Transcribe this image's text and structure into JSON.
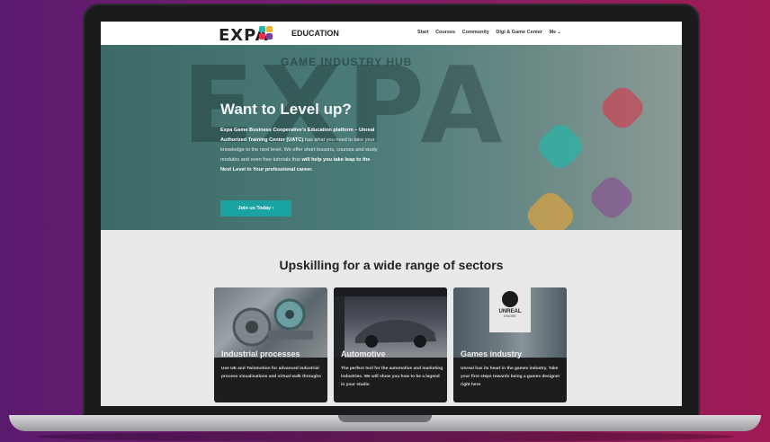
{
  "nav": {
    "logo_text": "EXPA",
    "section": "EDUCATION",
    "items": [
      "Start",
      "Courses",
      "Community",
      "Digi & Game Center",
      "Me"
    ],
    "menu_caret": "⌄"
  },
  "hero": {
    "background_text": "EXPA",
    "background_subtext": "GAME INDUSTRY HUB",
    "title": "Want to Level up?",
    "text_1": "Expa Game Business Cooperative's Education platform – Unreal Authorized Training Center (UATC)",
    "text_2": " has what you need to take your knowledge to the next level. We offer short lessons, courses and study modules and even free tutorials that ",
    "text_3": "will help you take leap to the Next Level in Your professional career.",
    "button_label": "Join us Today",
    "button_arrow": "›"
  },
  "section": {
    "title": "Upskilling for a wide range of sectors"
  },
  "cards": [
    {
      "title": "Industrial processes",
      "description": "Use UE and Twinmotion for advanced industrial process visualisations and virtual walk throughs"
    },
    {
      "title": "Automotive",
      "description": "The perfect tool for the automotive and marketing industries. We will show you how to be a legend in your studio"
    },
    {
      "title": "Games industry",
      "description": "Unreal has its heart in the games industry. Take your first steps towards being a games designer right here"
    }
  ],
  "logo_badge": {
    "line1": "UNREAL",
    "line2": "ENGINE"
  },
  "colors": {
    "accent": "#1aa3a3",
    "dot_red": "#e8334a",
    "dot_yellow": "#f2b233",
    "dot_teal": "#2bb3a6",
    "dot_purple": "#7a3fa0"
  }
}
